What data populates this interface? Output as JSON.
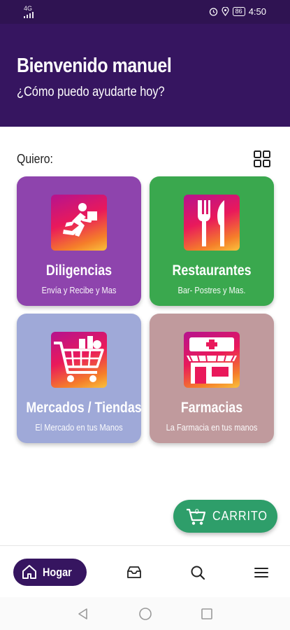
{
  "status_bar": {
    "signal_label": "4G",
    "battery": "86",
    "time": "4:50"
  },
  "header": {
    "greeting": "Bienvenido manuel",
    "subtitle": "¿Cómo puedo ayudarte hoy?"
  },
  "section": {
    "label": "Quiero:"
  },
  "categories": [
    {
      "title": "Diligencias",
      "subtitle": "Envía y Recibe y Mas",
      "color": "#8e44ad",
      "icon": "delivery-runner-icon"
    },
    {
      "title": "Restaurantes",
      "subtitle": "Bar- Postres y Mas.",
      "color": "#3aa84e",
      "icon": "fork-knife-icon"
    },
    {
      "title": "Mercados / Tiendas",
      "subtitle": "El Mercado en tus Manos",
      "color": "#9fa9d8",
      "icon": "shopping-cart-icon"
    },
    {
      "title": "Farmacias",
      "subtitle": "La Farmacia en tus manos",
      "color": "#c09a9d",
      "icon": "pharmacy-store-icon"
    }
  ],
  "cart": {
    "count": "0",
    "label": "CARRITO",
    "color": "#2e9e6a"
  },
  "bottom_nav": {
    "home_label": "Hogar",
    "accent": "#361560"
  }
}
